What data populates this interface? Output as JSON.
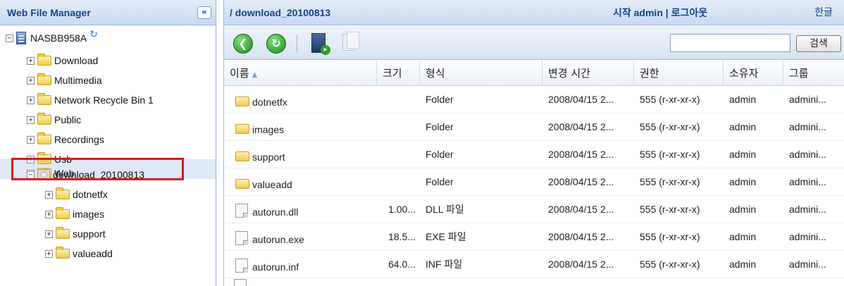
{
  "left_panel": {
    "title": "Web File Manager",
    "collapse_glyph": "«",
    "tree": {
      "root": "NASBB958A",
      "folders": [
        "Download",
        "Multimedia",
        "Network Recycle Bin 1",
        "Public",
        "Recordings",
        "Usb",
        "Web"
      ],
      "selected": "download_20100813",
      "children": [
        "dotnetfx",
        "images",
        "support",
        "valueadd"
      ]
    }
  },
  "right_panel": {
    "path": "/ download_20100813",
    "session": "시작 admin | 로그아웃",
    "language": "한글",
    "search_button": "검색",
    "search_value": "",
    "columns": [
      "이름",
      "크기",
      "형식",
      "변경 시간",
      "권한",
      "소유자",
      "그룹"
    ],
    "rows": [
      {
        "icon": "folder-icon",
        "name": "dotnetfx",
        "size": "",
        "type": "Folder",
        "modified": "2008/04/15 2...",
        "perm": "555 (r-xr-xr-x)",
        "owner": "admin",
        "group": "admini..."
      },
      {
        "icon": "folder-icon",
        "name": "images",
        "size": "",
        "type": "Folder",
        "modified": "2008/04/15 2...",
        "perm": "555 (r-xr-xr-x)",
        "owner": "admin",
        "group": "admini..."
      },
      {
        "icon": "folder-icon",
        "name": "support",
        "size": "",
        "type": "Folder",
        "modified": "2008/04/15 2...",
        "perm": "555 (r-xr-xr-x)",
        "owner": "admin",
        "group": "admini..."
      },
      {
        "icon": "folder-icon",
        "name": "valueadd",
        "size": "",
        "type": "Folder",
        "modified": "2008/04/15 2...",
        "perm": "555 (r-xr-xr-x)",
        "owner": "admin",
        "group": "admini..."
      },
      {
        "icon": "file-icon",
        "name": "autorun.dll",
        "size": "1.00...",
        "type": "DLL 파일",
        "modified": "2008/04/15 2...",
        "perm": "555 (r-xr-xr-x)",
        "owner": "admin",
        "group": "admini..."
      },
      {
        "icon": "file-icon",
        "name": "autorun.exe",
        "size": "18.5...",
        "type": "EXE 파일",
        "modified": "2008/04/15 2...",
        "perm": "555 (r-xr-xr-x)",
        "owner": "admin",
        "group": "admini..."
      },
      {
        "icon": "file-icon",
        "name": "autorun.inf",
        "size": "64.0...",
        "type": "INF 파일",
        "modified": "2008/04/15 2...",
        "perm": "555 (r-xr-xr-x)",
        "owner": "admin",
        "group": "admini..."
      }
    ]
  },
  "colors": {
    "header_text": "#15428b",
    "highlight_border": "#e0141c",
    "selected_background": "#dfe8f6"
  }
}
